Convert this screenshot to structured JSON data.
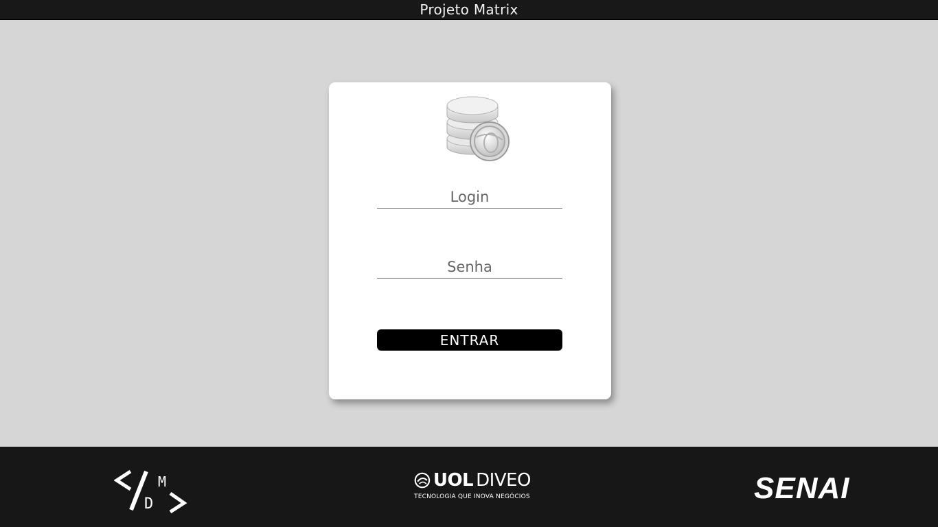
{
  "header": {
    "title": "Projeto Matrix"
  },
  "login_card": {
    "icon": "database-icon",
    "login_placeholder": "Login",
    "password_placeholder": "Senha",
    "submit_label": "ENTRAR"
  },
  "footer": {
    "logos": [
      {
        "name": "mdd-logo",
        "text": "MD"
      },
      {
        "name": "uol-diveo-logo",
        "brand_bold": "UOL",
        "brand": "DIVEO",
        "tagline": "TECNOLOGIA QUE INOVA NEGÓCIOS"
      },
      {
        "name": "senai-logo",
        "text": "SENAI"
      }
    ]
  },
  "colors": {
    "background": "#d6d6d6",
    "bar": "#181818",
    "card": "#ffffff",
    "button": "#000000"
  }
}
